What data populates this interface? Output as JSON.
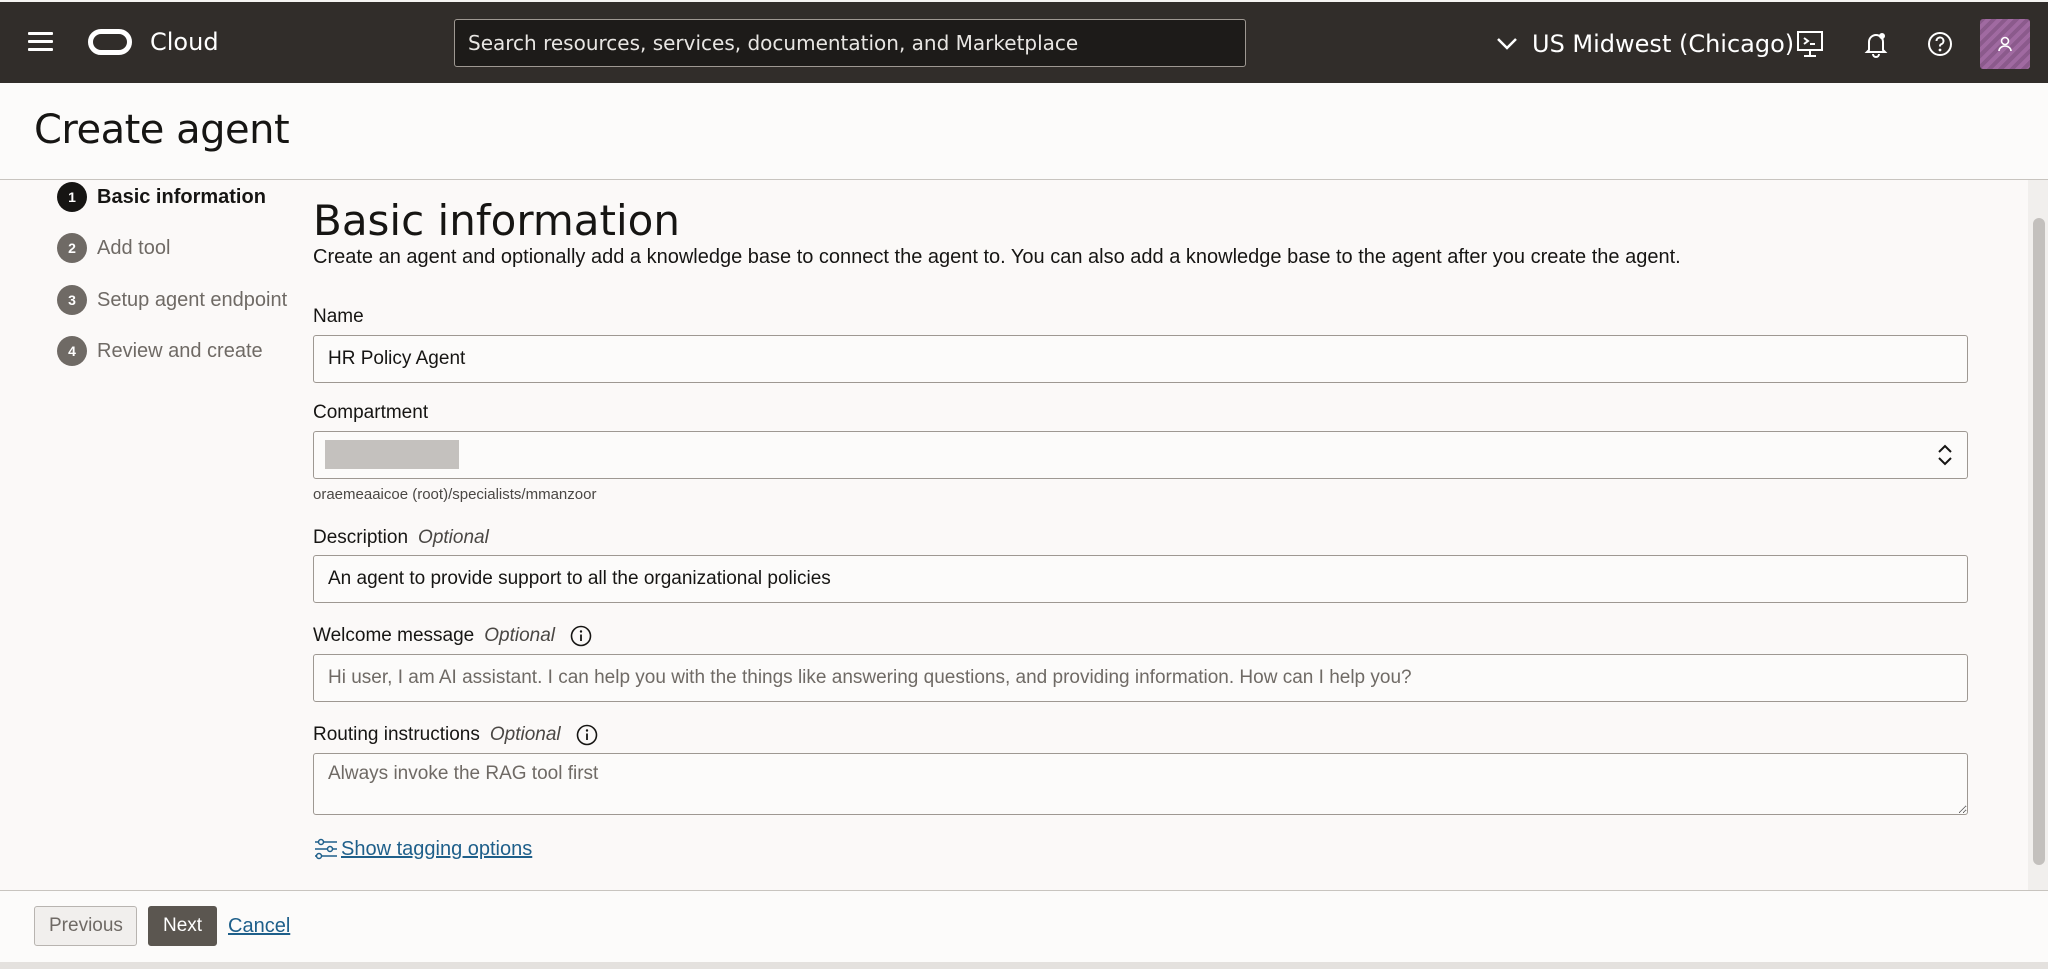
{
  "topbar": {
    "brand": "Cloud",
    "search_placeholder": "Search resources, services, documentation, and Marketplace",
    "region": "US Midwest (Chicago)"
  },
  "page": {
    "title": "Create agent"
  },
  "steps": [
    {
      "number": "1",
      "label": "Basic information"
    },
    {
      "number": "2",
      "label": "Add tool"
    },
    {
      "number": "3",
      "label": "Setup agent endpoint"
    },
    {
      "number": "4",
      "label": "Review and create"
    }
  ],
  "form": {
    "section_title": "Basic information",
    "section_description": "Create an agent and optionally add a knowledge base to connect the agent to. You can also add a knowledge base to the agent after you create the agent.",
    "name_label": "Name",
    "name_value": "HR Policy Agent",
    "compartment_label": "Compartment",
    "compartment_hint": "oraemeaaicoe (root)/specialists/mmanzoor",
    "description_label": "Description",
    "optional_text": "Optional",
    "description_value": "An agent to provide support to all the organizational policies",
    "welcome_label": "Welcome message",
    "welcome_placeholder": "Hi user, I am AI assistant. I can help you with the things like answering questions, and providing information. How can I help you?",
    "routing_label": "Routing instructions",
    "routing_placeholder": "Always invoke the RAG tool first",
    "tagging_link": "Show tagging options"
  },
  "footer": {
    "previous": "Previous",
    "next": "Next",
    "cancel": "Cancel"
  }
}
